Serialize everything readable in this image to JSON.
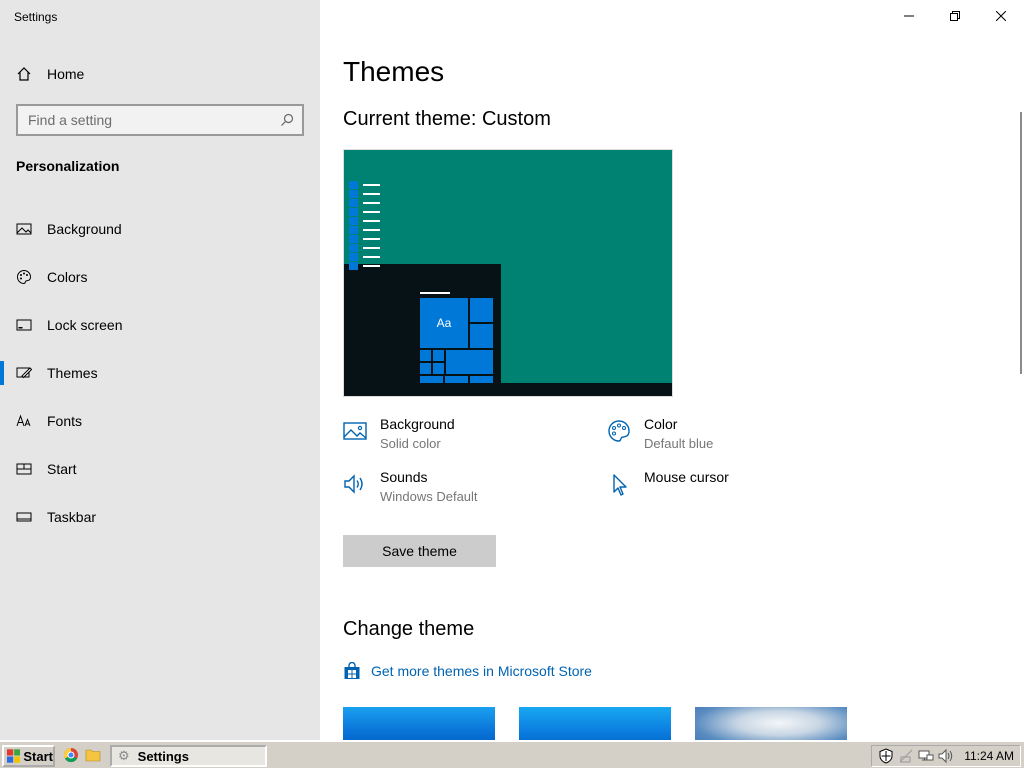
{
  "window": {
    "title": "Settings",
    "controls": {
      "minimize": "minimize-icon",
      "restore": "restore-icon",
      "close": "close-icon"
    }
  },
  "sidebar": {
    "home_label": "Home",
    "search": {
      "placeholder": "Find a setting"
    },
    "section_title": "Personalization",
    "items": [
      {
        "label": "Background",
        "icon": "picture-icon"
      },
      {
        "label": "Colors",
        "icon": "palette-icon"
      },
      {
        "label": "Lock screen",
        "icon": "lock-screen-icon"
      },
      {
        "label": "Themes",
        "icon": "themes-icon",
        "selected": true
      },
      {
        "label": "Fonts",
        "icon": "fonts-icon"
      },
      {
        "label": "Start",
        "icon": "start-icon"
      },
      {
        "label": "Taskbar",
        "icon": "taskbar-icon"
      }
    ]
  },
  "main": {
    "title": "Themes",
    "current_theme": "Current theme: Custom",
    "preview": {
      "sample_text": "Aa",
      "desktop_color": "#008272",
      "accent_color": "#0078d7"
    },
    "properties": [
      {
        "title": "Background",
        "subtitle": "Solid color",
        "icon": "picture-icon"
      },
      {
        "title": "Color",
        "subtitle": "Default blue",
        "icon": "palette-icon"
      },
      {
        "title": "Sounds",
        "subtitle": "Windows Default",
        "icon": "speaker-icon"
      },
      {
        "title": "Mouse cursor",
        "subtitle": "",
        "icon": "cursor-icon"
      }
    ],
    "save_button": "Save theme",
    "change_theme_title": "Change theme",
    "store_link": "Get more themes in Microsoft Store"
  },
  "os_taskbar": {
    "start_label": "Start",
    "task_label": "Settings",
    "clock": "11:24 AM"
  }
}
